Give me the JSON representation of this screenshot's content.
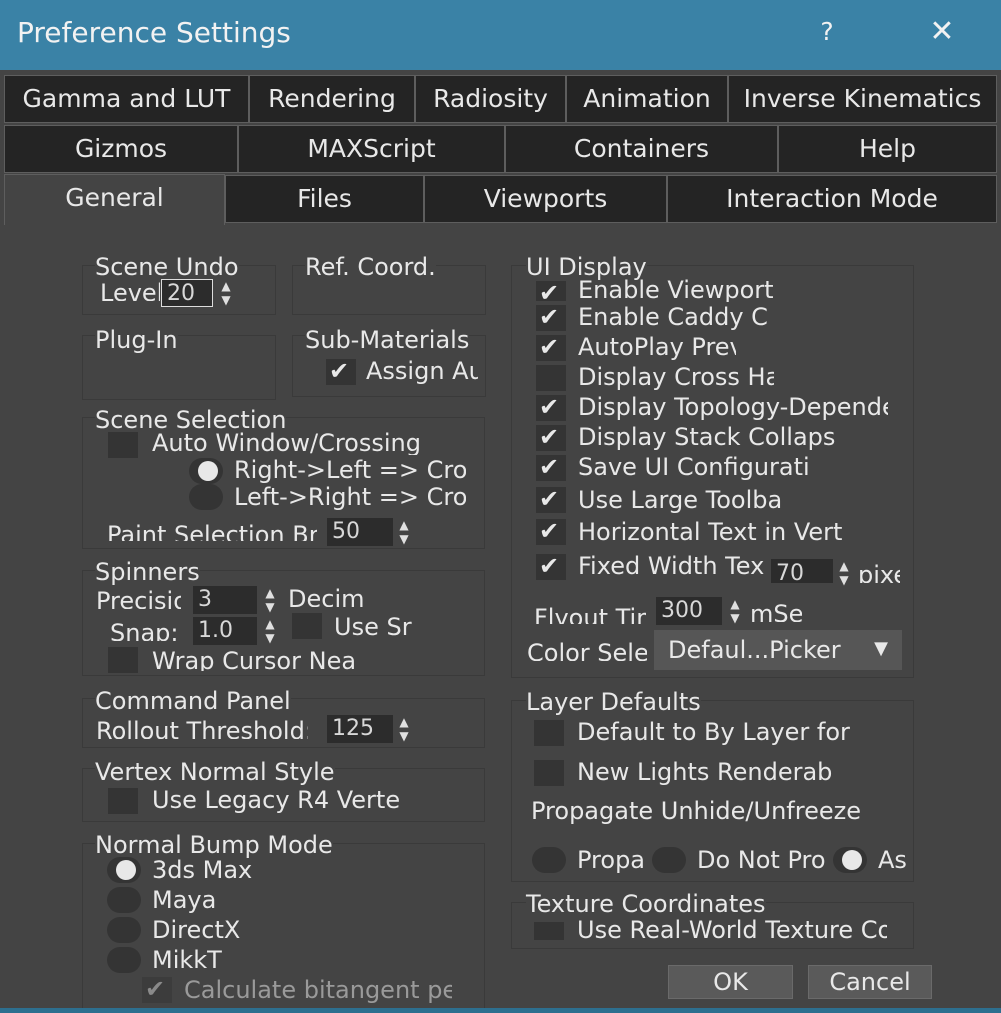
{
  "window": {
    "title": "Preference Settings",
    "help": "?",
    "close": "✕"
  },
  "tabs": {
    "row1": [
      "Gamma and LUT",
      "Rendering",
      "Radiosity",
      "Animation",
      "Inverse Kinematics"
    ],
    "row2": [
      "Gizmos",
      "MAXScript",
      "Containers",
      "Help"
    ],
    "row3": [
      "General",
      "Files",
      "Viewports",
      "Interaction Mode"
    ],
    "active": "General"
  },
  "scene_undo": {
    "title": "Scene Undo",
    "levels_label": "Levels:",
    "levels_value": "20"
  },
  "ref_coord": {
    "title": "Ref. Coord."
  },
  "plugin": {
    "title": "Plug-In"
  },
  "sub_materials": {
    "title": "Sub-Materials",
    "assign_label": "Assign Au",
    "assign_checked": true
  },
  "scene_selection": {
    "title": "Scene Selection",
    "auto_window_label": "Auto Window/Crossing",
    "right_left_label": "Right->Left => Cro",
    "left_right_label": "Left->Right => Cro",
    "paint_brush_label": "Paint Selection Bru",
    "paint_brush_value": "50"
  },
  "spinners": {
    "title": "Spinners",
    "precision_label": "Precision:",
    "precision_value": "3",
    "decimal_label": "Decima",
    "snap_label": "Snap:",
    "snap_value": "1.0",
    "use_snap_label": "Use Sr",
    "wrap_cursor_label": "Wrap Cursor Nea"
  },
  "command_panel": {
    "title": "Command Panel",
    "rollout_label": "Rollout Threshold:",
    "rollout_value": "125"
  },
  "vertex_normal": {
    "title": "Vertex Normal Style",
    "legacy_label": "Use Legacy R4 Verte"
  },
  "normal_bump": {
    "title": "Normal Bump Mode",
    "options": [
      "3ds Max",
      "Maya",
      "DirectX",
      "MikkT"
    ],
    "selected": "3ds Max",
    "bitangent_label": "Calculate bitangent per"
  },
  "ui_display": {
    "title": "UI Display",
    "items": [
      {
        "label": "Enable Viewport",
        "checked": true
      },
      {
        "label": "Enable Caddy C",
        "checked": true
      },
      {
        "label": "AutoPlay Prev",
        "checked": true
      },
      {
        "label": "Display Cross Ha",
        "checked": false
      },
      {
        "label": "Display Topology-Depende",
        "checked": true
      },
      {
        "label": "Display Stack Collaps",
        "checked": true
      },
      {
        "label": "Save UI Configurati",
        "checked": true
      },
      {
        "label": "Use Large Toolba",
        "checked": true
      },
      {
        "label": "Horizontal Text in Vert",
        "checked": true
      },
      {
        "label": "Fixed Width Tex",
        "checked": true
      }
    ],
    "fixed_width_value": "70",
    "pixels_label": "pixe",
    "flyout_label": "Flyout Time:",
    "flyout_value": "300",
    "ms_label": "mSe",
    "color_selector_label": "Color Sele",
    "color_selector_value": "Defaul...Picker"
  },
  "layer_defaults": {
    "title": "Layer Defaults",
    "default_bylayer_label": "Default to By Layer for",
    "new_lights_label": "New Lights Renderab",
    "propagate_label": "Propagate Unhide/Unfreeze",
    "prop_options": [
      "Propa",
      "Do Not Pro",
      "As"
    ],
    "prop_selected": "As"
  },
  "texture_coords": {
    "title": "Texture Coordinates",
    "real_world_label": "Use Real-World Texture Co"
  },
  "buttons": {
    "ok": "OK",
    "cancel": "Cancel"
  }
}
